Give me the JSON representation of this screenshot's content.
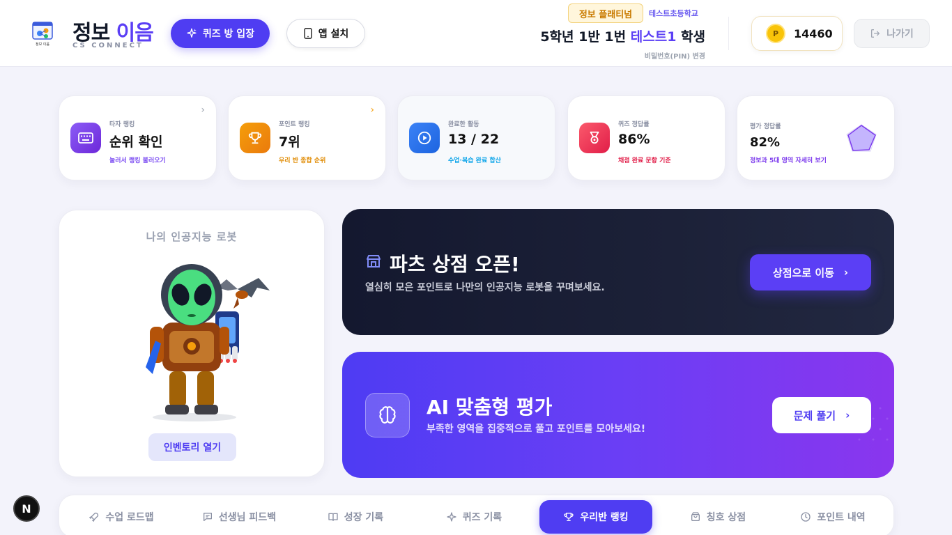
{
  "brand": {
    "title_main": "정보",
    "title_accent": "이음",
    "subtitle": "CS CONNECT",
    "logo_caption": "정보 이음"
  },
  "header": {
    "quiz_button": "퀴즈 방 입장",
    "app_button": "앱 설치",
    "tier_badge": "정보 플래티넘",
    "school": "테스트초등학교",
    "student_prefix": "5학년 1반 1번 ",
    "student_name": "테스트1",
    "student_suffix": " 학생",
    "pin_link": "비밀번호(PIN) 변경",
    "coin_symbol": "P",
    "points": "14460",
    "exit_button": "나가기"
  },
  "stats": [
    {
      "label": "타자 랭킹",
      "value": "순위 확인",
      "sub": "눌러서 랭킹 불러오기",
      "icon": "keyboard-icon",
      "color": "#7c4df2",
      "sub_color": "#7c4df2"
    },
    {
      "label": "포인트 랭킹",
      "value": "7위",
      "sub": "우리 반 종합 순위",
      "icon": "trophy-icon",
      "color": "#f08a0c",
      "sub_color": "#e08a00"
    },
    {
      "label": "완료한 활동",
      "value": "13 / 22",
      "sub": "수업·복습 완료 합산",
      "icon": "play-icon",
      "color": "#1d7cf2",
      "sub_color": "#0ea5e9"
    },
    {
      "label": "퀴즈 정답률",
      "value": "86%",
      "sub": "채점 완료 문항 기준",
      "icon": "medal-icon",
      "color": "#f0435a",
      "sub_color": "#e11d48"
    },
    {
      "label": "평가 정답률",
      "value": "82%",
      "sub": "정보과 5대 영역 자세히 보기",
      "icon": "radar-chart-icon",
      "color": "#8b5cf6",
      "sub_color": "#7c3aed"
    }
  ],
  "robot": {
    "title": "나의 인공지능 로봇",
    "inventory_button": "인벤토리 열기"
  },
  "shop": {
    "title": "파츠 상점 오픈!",
    "description": "열심히 모은 포인트로 나만의 인공지능 로봇을 꾸며보세요.",
    "button": "상점으로 이동"
  },
  "ai": {
    "title": "AI 맞춤형 평가",
    "description": "부족한 영역을 집중적으로 풀고 포인트를 모아보세요!",
    "button": "문제 풀기"
  },
  "nav": [
    {
      "label": "수업 로드맵",
      "icon": "rocket-icon",
      "active": false
    },
    {
      "label": "선생님 피드백",
      "icon": "message-icon",
      "active": false
    },
    {
      "label": "성장 기록",
      "icon": "book-icon",
      "active": false
    },
    {
      "label": "퀴즈 기록",
      "icon": "sparkle-icon",
      "active": false
    },
    {
      "label": "우리반 랭킹",
      "icon": "trophy-icon",
      "active": true
    },
    {
      "label": "칭호 상점",
      "icon": "shopping-bag-icon",
      "active": false
    },
    {
      "label": "포인트 내역",
      "icon": "clock-icon",
      "active": false
    }
  ],
  "dev_badge": "N"
}
